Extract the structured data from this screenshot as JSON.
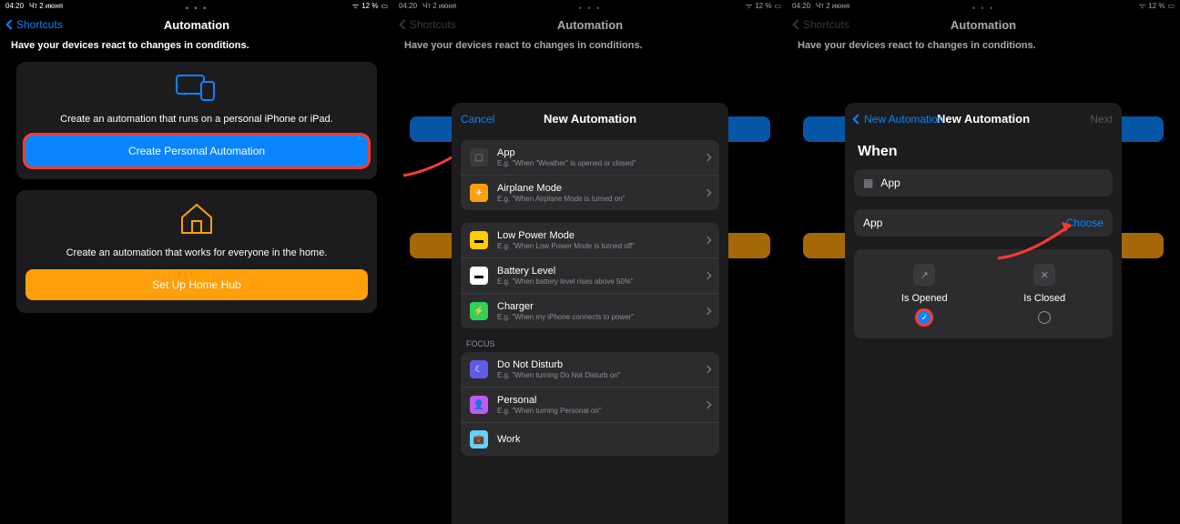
{
  "status": {
    "time": "04:20",
    "date": "Чт 2 июня",
    "battery": "12 %"
  },
  "header": {
    "back": "Shortcuts",
    "title": "Automation"
  },
  "subtitle": "Have your devices react to changes in conditions.",
  "personal": {
    "desc": "Create an automation that runs on a personal iPhone or iPad.",
    "button": "Create Personal Automation"
  },
  "home": {
    "desc": "Create an automation that works for everyone in the home.",
    "button": "Set Up Home Hub"
  },
  "sheet2": {
    "cancel": "Cancel",
    "title": "New Automation",
    "group1": [
      {
        "title": "App",
        "sub": "E.g. \"When \"Weather\" is opened or closed\""
      },
      {
        "title": "Airplane Mode",
        "sub": "E.g. \"When Airplane Mode is turned on\""
      }
    ],
    "group2": [
      {
        "title": "Low Power Mode",
        "sub": "E.g. \"When Low Power Mode is turned off\""
      },
      {
        "title": "Battery Level",
        "sub": "E.g. \"When battery level rises above 50%\""
      },
      {
        "title": "Charger",
        "sub": "E.g. \"When my iPhone connects to power\""
      }
    ],
    "focus_label": "FOCUS",
    "group3": [
      {
        "title": "Do Not Disturb",
        "sub": "E.g. \"When turning Do Not Disturb on\""
      },
      {
        "title": "Personal",
        "sub": "E.g. \"When turning Personal on\""
      },
      {
        "title": "Work",
        "sub": ""
      }
    ]
  },
  "sheet3": {
    "back": "New Automation",
    "title": "New Automation",
    "next": "Next",
    "when": "When",
    "app_row": "App",
    "app_label": "App",
    "choose": "Choose",
    "opt_open": "Is Opened",
    "opt_close": "Is Closed"
  }
}
